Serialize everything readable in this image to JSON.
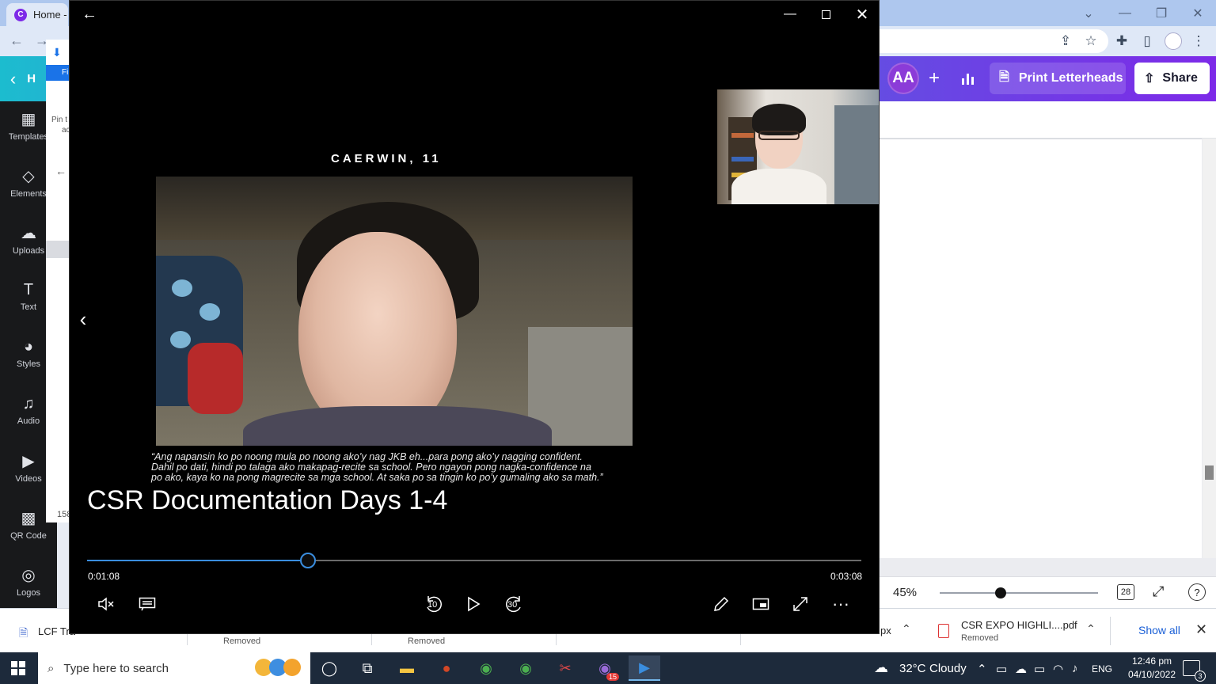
{
  "browser": {
    "tab_title": "Home -",
    "tab_favicon": "C",
    "bookmark_snippet": "Fi",
    "panel_pin_text_1": "Pin t",
    "panel_pin_text_2": "ac",
    "panel_count": "158"
  },
  "canva": {
    "back_label": "H",
    "sidebar": [
      {
        "label": "Templates",
        "icon": "templates-icon"
      },
      {
        "label": "Elements",
        "icon": "elements-icon"
      },
      {
        "label": "Uploads",
        "icon": "uploads-icon"
      },
      {
        "label": "Text",
        "icon": "text-icon"
      },
      {
        "label": "Styles",
        "icon": "styles-icon"
      },
      {
        "label": "Audio",
        "icon": "audio-icon"
      },
      {
        "label": "Videos",
        "icon": "videos-icon"
      },
      {
        "label": "QR Code",
        "icon": "qr-code-icon"
      },
      {
        "label": "Logos",
        "icon": "logos-icon"
      }
    ],
    "avatar_initials": "AA",
    "print_label": "Print Letterheads",
    "share_label": "Share",
    "zoom_percent": "45%",
    "page_count": "28"
  },
  "downloads": {
    "items": [
      {
        "name": "LCF Tra",
        "status": ""
      },
      {
        "name": "",
        "status": "Removed"
      },
      {
        "name": "",
        "status": "Removed"
      },
      {
        "name": "CSR EXPO HIGHLI....pdf",
        "status": "Removed"
      }
    ],
    "partial_ext": "px",
    "show_all": "Show all"
  },
  "taskbar": {
    "search_placeholder": "Type here to search",
    "weather_temp": "32°C",
    "weather_desc": "Cloudy",
    "language": "ENG",
    "time": "12:46 pm",
    "date": "04/10/2022",
    "notification_count": "3",
    "viber_badge": "15"
  },
  "player": {
    "speaker_label": "CAERWIN, 11",
    "quote_line_1": "“Ang napansin ko po noong mula po noong ako’y nag JKB eh...para pong ako’y nagging confident.",
    "quote_line_2": "Dahil po dati, hindi po talaga ako makapag-recite sa school. Pero ngayon pong nagka-confidence na",
    "quote_line_3": "po ako, kaya ko na pong magrecite sa mga school. At saka po sa tingin ko po’y gumaling ako sa math.”",
    "video_title": "CSR Documentation Days 1-4",
    "elapsed": "0:01:08",
    "duration": "0:03:08",
    "progress_fraction": 0.2857,
    "skip_back_seconds": "10",
    "skip_forward_seconds": "30",
    "accent_color": "#3a8dde"
  }
}
